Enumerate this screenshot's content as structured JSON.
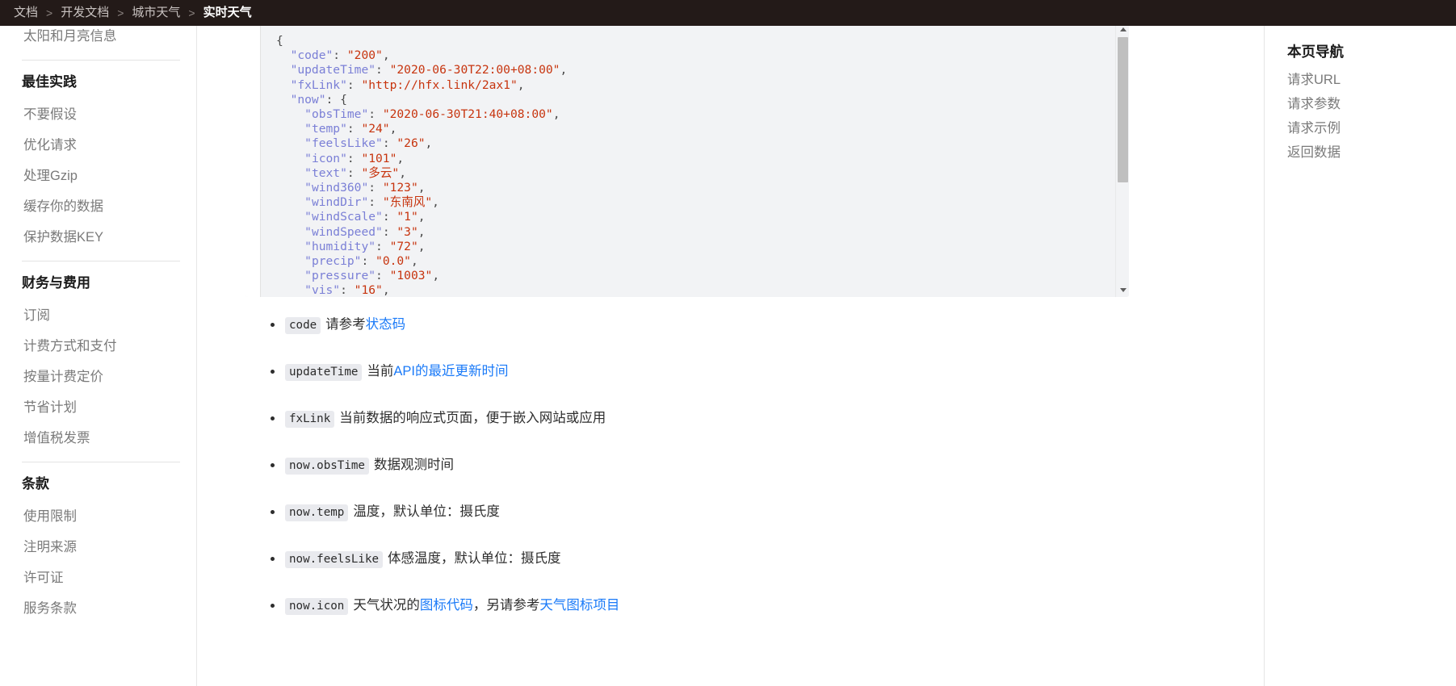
{
  "breadcrumb": {
    "separator": ">",
    "items": [
      {
        "label": "文档",
        "active": false
      },
      {
        "label": "开发文档",
        "active": false
      },
      {
        "label": "城市天气",
        "active": false
      },
      {
        "label": "实时天气",
        "active": true
      }
    ]
  },
  "sidebar": {
    "top_partial_item": "太阳和月亮信息",
    "groups": [
      {
        "title": "最佳实践",
        "items": [
          "不要假设",
          "优化请求",
          "处理Gzip",
          "缓存你的数据",
          "保护数据KEY"
        ]
      },
      {
        "title": "财务与费用",
        "items": [
          "订阅",
          "计费方式和支付",
          "按量计费定价",
          "节省计划",
          "增值税发票"
        ]
      },
      {
        "title": "条款",
        "items": [
          "使用限制",
          "注明来源",
          "许可证",
          "服务条款"
        ]
      }
    ]
  },
  "code_block": {
    "language": "json",
    "lines": [
      {
        "indent": 0,
        "parts": [
          {
            "t": "punc",
            "v": "{"
          }
        ]
      },
      {
        "indent": 1,
        "parts": [
          {
            "t": "key",
            "v": "\"code\""
          },
          {
            "t": "punc",
            "v": ": "
          },
          {
            "t": "str",
            "v": "\"200\""
          },
          {
            "t": "punc",
            "v": ","
          }
        ]
      },
      {
        "indent": 1,
        "parts": [
          {
            "t": "key",
            "v": "\"updateTime\""
          },
          {
            "t": "punc",
            "v": ": "
          },
          {
            "t": "str",
            "v": "\"2020-06-30T22:00+08:00\""
          },
          {
            "t": "punc",
            "v": ","
          }
        ]
      },
      {
        "indent": 1,
        "parts": [
          {
            "t": "key",
            "v": "\"fxLink\""
          },
          {
            "t": "punc",
            "v": ": "
          },
          {
            "t": "str",
            "v": "\"http://hfx.link/2ax1\""
          },
          {
            "t": "punc",
            "v": ","
          }
        ]
      },
      {
        "indent": 1,
        "parts": [
          {
            "t": "key",
            "v": "\"now\""
          },
          {
            "t": "punc",
            "v": ": {"
          }
        ]
      },
      {
        "indent": 2,
        "parts": [
          {
            "t": "key",
            "v": "\"obsTime\""
          },
          {
            "t": "punc",
            "v": ": "
          },
          {
            "t": "str",
            "v": "\"2020-06-30T21:40+08:00\""
          },
          {
            "t": "punc",
            "v": ","
          }
        ]
      },
      {
        "indent": 2,
        "parts": [
          {
            "t": "key",
            "v": "\"temp\""
          },
          {
            "t": "punc",
            "v": ": "
          },
          {
            "t": "str",
            "v": "\"24\""
          },
          {
            "t": "punc",
            "v": ","
          }
        ]
      },
      {
        "indent": 2,
        "parts": [
          {
            "t": "key",
            "v": "\"feelsLike\""
          },
          {
            "t": "punc",
            "v": ": "
          },
          {
            "t": "str",
            "v": "\"26\""
          },
          {
            "t": "punc",
            "v": ","
          }
        ]
      },
      {
        "indent": 2,
        "parts": [
          {
            "t": "key",
            "v": "\"icon\""
          },
          {
            "t": "punc",
            "v": ": "
          },
          {
            "t": "str",
            "v": "\"101\""
          },
          {
            "t": "punc",
            "v": ","
          }
        ]
      },
      {
        "indent": 2,
        "parts": [
          {
            "t": "key",
            "v": "\"text\""
          },
          {
            "t": "punc",
            "v": ": "
          },
          {
            "t": "str",
            "v": "\"多云\""
          },
          {
            "t": "punc",
            "v": ","
          }
        ]
      },
      {
        "indent": 2,
        "parts": [
          {
            "t": "key",
            "v": "\"wind360\""
          },
          {
            "t": "punc",
            "v": ": "
          },
          {
            "t": "str",
            "v": "\"123\""
          },
          {
            "t": "punc",
            "v": ","
          }
        ]
      },
      {
        "indent": 2,
        "parts": [
          {
            "t": "key",
            "v": "\"windDir\""
          },
          {
            "t": "punc",
            "v": ": "
          },
          {
            "t": "str",
            "v": "\"东南风\""
          },
          {
            "t": "punc",
            "v": ","
          }
        ]
      },
      {
        "indent": 2,
        "parts": [
          {
            "t": "key",
            "v": "\"windScale\""
          },
          {
            "t": "punc",
            "v": ": "
          },
          {
            "t": "str",
            "v": "\"1\""
          },
          {
            "t": "punc",
            "v": ","
          }
        ]
      },
      {
        "indent": 2,
        "parts": [
          {
            "t": "key",
            "v": "\"windSpeed\""
          },
          {
            "t": "punc",
            "v": ": "
          },
          {
            "t": "str",
            "v": "\"3\""
          },
          {
            "t": "punc",
            "v": ","
          }
        ]
      },
      {
        "indent": 2,
        "parts": [
          {
            "t": "key",
            "v": "\"humidity\""
          },
          {
            "t": "punc",
            "v": ": "
          },
          {
            "t": "str",
            "v": "\"72\""
          },
          {
            "t": "punc",
            "v": ","
          }
        ]
      },
      {
        "indent": 2,
        "parts": [
          {
            "t": "key",
            "v": "\"precip\""
          },
          {
            "t": "punc",
            "v": ": "
          },
          {
            "t": "str",
            "v": "\"0.0\""
          },
          {
            "t": "punc",
            "v": ","
          }
        ]
      },
      {
        "indent": 2,
        "parts": [
          {
            "t": "key",
            "v": "\"pressure\""
          },
          {
            "t": "punc",
            "v": ": "
          },
          {
            "t": "str",
            "v": "\"1003\""
          },
          {
            "t": "punc",
            "v": ","
          }
        ]
      },
      {
        "indent": 2,
        "parts": [
          {
            "t": "key",
            "v": "\"vis\""
          },
          {
            "t": "punc",
            "v": ": "
          },
          {
            "t": "str",
            "v": "\"16\""
          },
          {
            "t": "punc",
            "v": ","
          }
        ]
      }
    ]
  },
  "field_list": [
    {
      "code": "code",
      "segments": [
        {
          "type": "text",
          "v": "请参考"
        },
        {
          "type": "link",
          "v": "状态码"
        }
      ]
    },
    {
      "code": "updateTime",
      "segments": [
        {
          "type": "text",
          "v": "当前"
        },
        {
          "type": "link",
          "v": "API的最近更新时间"
        }
      ]
    },
    {
      "code": "fxLink",
      "segments": [
        {
          "type": "text",
          "v": "当前数据的响应式页面，便于嵌入网站或应用"
        }
      ]
    },
    {
      "code": "now.obsTime",
      "segments": [
        {
          "type": "text",
          "v": "数据观测时间"
        }
      ]
    },
    {
      "code": "now.temp",
      "segments": [
        {
          "type": "text",
          "v": "温度，默认单位：摄氏度"
        }
      ]
    },
    {
      "code": "now.feelsLike",
      "segments": [
        {
          "type": "text",
          "v": "体感温度，默认单位：摄氏度"
        }
      ]
    },
    {
      "code": "now.icon",
      "segments": [
        {
          "type": "text",
          "v": "天气状况的"
        },
        {
          "type": "link",
          "v": "图标代码"
        },
        {
          "type": "text",
          "v": "，另请参考"
        },
        {
          "type": "link",
          "v": "天气图标项目"
        }
      ]
    }
  ],
  "toc": {
    "title": "本页导航",
    "items": [
      "请求URL",
      "请求参数",
      "请求示例",
      "返回数据"
    ]
  },
  "colors": {
    "breadcrumb_bg": "#231a18",
    "code_bg": "#f2f3f5",
    "link": "#1a7af8",
    "json_key": "#7a7fd6",
    "json_string": "#c7340e",
    "inline_code_bg": "#e9eaee"
  }
}
